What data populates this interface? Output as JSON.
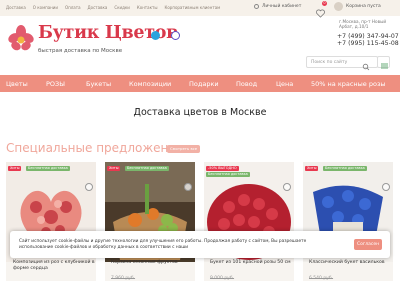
{
  "topbar": {
    "nav": [
      "Доставка",
      "О компании",
      "Оплата",
      "Доставка",
      "Скидки",
      "Контакты",
      "Корпоративным клиентам"
    ],
    "cabinet": "Личный кабинет",
    "fav_count": "0",
    "cart_label": "Корзина пуста"
  },
  "header": {
    "logo_title": "Бутик Цветов",
    "logo_sub": "быстрая доставка по Москве",
    "address": "г.Москва, пр-т Новый Арбат, д.10/1",
    "phone1": "+7 (499) 347-94-07",
    "phone2": "+7 (995) 115-45-08"
  },
  "menu": [
    "Цветы",
    "РОЗЫ",
    "Букеты",
    "Композиции",
    "Подарки",
    "Повод",
    "Цена",
    "50% на красные розы"
  ],
  "search": {
    "placeholder": "Поиск по сайту"
  },
  "page_title": "Доставка цветов в Москве",
  "section": {
    "title": "Специальные предложения",
    "see_all": "Смотреть все"
  },
  "cards": [
    {
      "badges": [
        "Хиты",
        "Бесплатная доставка"
      ],
      "name": "Композиция из роз с клубникой в форме сердца",
      "old_price": ""
    },
    {
      "badges": [
        "Хиты",
        "Бесплатная доставка"
      ],
      "name": "Корзина сезонных фруктов",
      "old_price": "7 960 руб."
    },
    {
      "badges": [
        "-50% ВЫГОДНО",
        "Бесплатная доставка"
      ],
      "name": "Букет из 101 красной розы 50 см",
      "old_price": "9 000 руб."
    },
    {
      "badges": [
        "Хиты",
        "Бесплатная доставка"
      ],
      "name": "Классический букет васильков",
      "old_price": "6 540 руб."
    }
  ],
  "cookie": {
    "text": "Сайт использует cookie-файлы и другие технологии для улучшения его работы. Продолжая работу с сайтом, Вы разрешаете использование cookie-файлов и обработку данных в соответствии с наши",
    "button": "Согласен"
  },
  "colors": {
    "accent": "#ee8f80",
    "brand": "#d9394b",
    "badge_red": "#e8384f",
    "badge_green": "#7ab66b"
  }
}
